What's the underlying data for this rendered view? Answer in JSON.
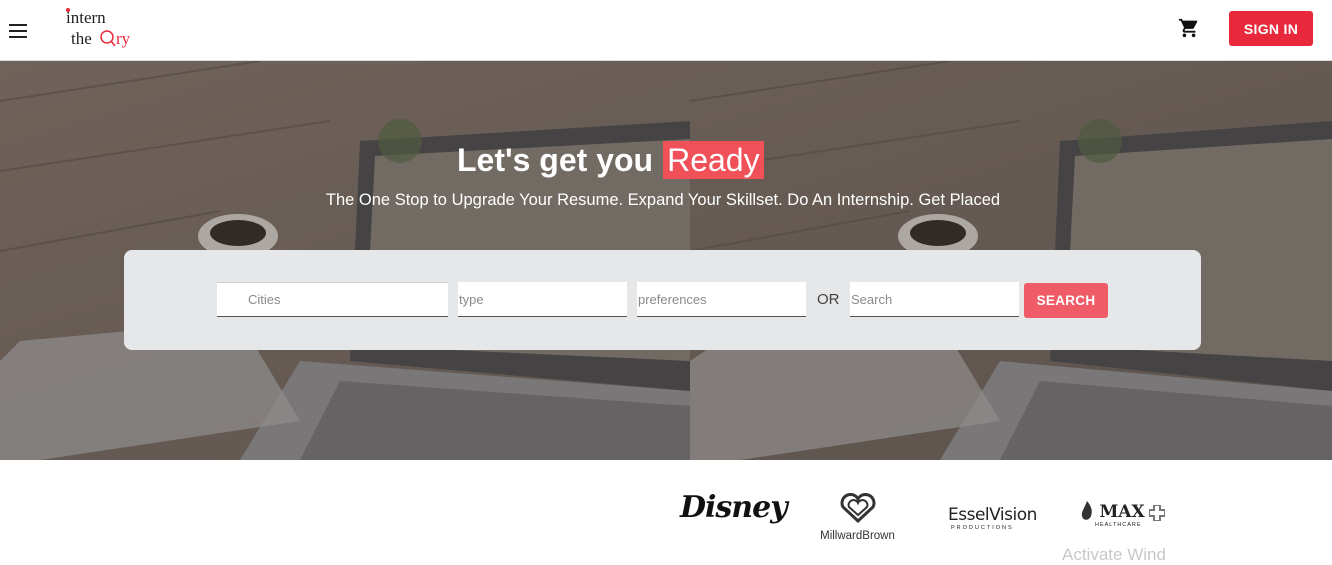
{
  "header": {
    "menu_icon": "hamburger-menu-icon",
    "logo_text": "intern theory",
    "cart_icon": "shopping-cart-icon",
    "signin_label": "SIGN IN"
  },
  "hero": {
    "headline": "Let's get you",
    "headline_highlight": "Ready",
    "tagline": "The One Stop to Upgrade Your Resume. Expand Your Skillset. Do An Internship. Get Placed",
    "search": {
      "cities_placeholder": "Cities",
      "type_placeholder": "type",
      "preferences_placeholder": "preferences",
      "or_label": "OR",
      "search_placeholder": "Search",
      "search_button": "SEARCH"
    }
  },
  "partners": {
    "logos": [
      "Disney",
      "MillwardBrown",
      "EsselVision",
      "MAX Healthcare"
    ],
    "millward_brown": "MillwardBrown",
    "essel_main": "EsselVision",
    "essel_sub": "PRODUCTIONS",
    "max_main": "MAX",
    "max_sub": "HEALTHCARE"
  },
  "overlay_text": "Activate Wind",
  "colors": {
    "accent_red": "#e8283b",
    "ready_highlight": "#f05159",
    "search_button": "#ef5b67",
    "panel_bg": "#e6e7e9"
  }
}
